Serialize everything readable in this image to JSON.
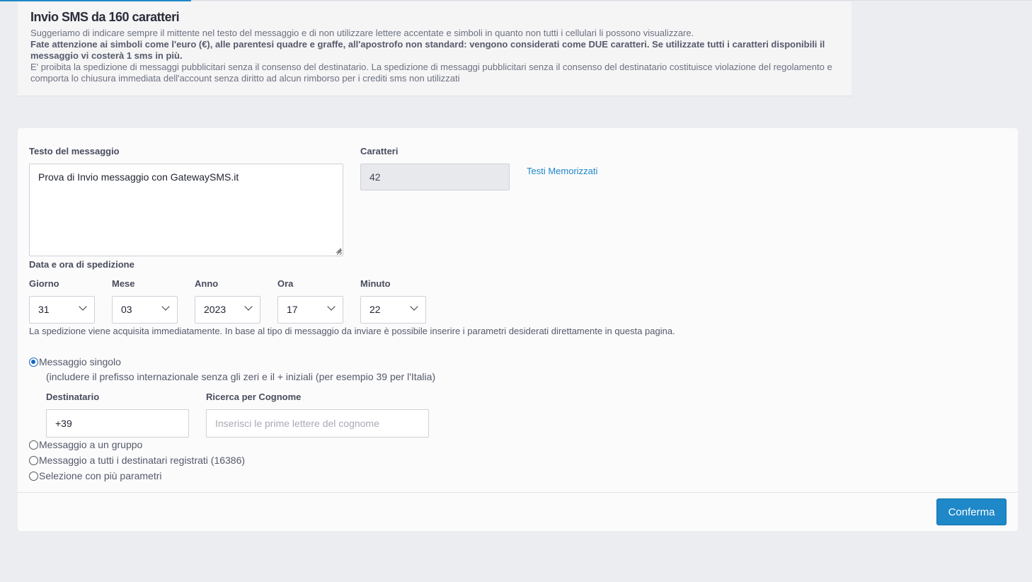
{
  "info": {
    "title": "Invio SMS da 160 caratteri",
    "line1": "Suggeriamo di indicare sempre il mittente nel testo del messaggio e di non utilizzare lettere accentate e simboli in quanto non tutti i cellulari li possono visualizzare.",
    "line2": "Fate attenzione ai simboli come l'euro (€), alle parentesi quadre e graffe, all'apostrofo non standard: vengono considerati come DUE caratteri. Se utilizzate tutti i caratteri disponibili il messaggio vi costerà 1 sms in più.",
    "line3": "E' proibita la spedizione di messaggi pubblicitari senza il consenso del destinatario. La spedizione di messaggi pubblicitari senza il consenso del destinatario costituisce violazione del regolamento e comporta lo chiusura immediata dell'account senza diritto ad alcun rimborso per i crediti sms non utilizzati"
  },
  "form": {
    "message_label": "Testo del messaggio",
    "message_value": "Prova di Invio messaggio con GatewaySMS.it",
    "chars_label": "Caratteri",
    "chars_value": "42",
    "saved_texts_link": "Testi Memorizzati",
    "datetime_label": "Data e ora di spedizione",
    "fields": {
      "day_label": "Giorno",
      "day_value": "31",
      "month_label": "Mese",
      "month_value": "03",
      "year_label": "Anno",
      "year_value": "2023",
      "hour_label": "Ora",
      "hour_value": "17",
      "minute_label": "Minuto",
      "minute_value": "22"
    },
    "note": "La spedizione viene acquisita immediatamente. In base al tipo di messaggio da inviare è possibile inserire i parametri desiderati direttamente in questa pagina.",
    "radios": {
      "single": "Messaggio singolo",
      "single_hint": "(includere il prefisso internazionale senza gli zeri e il + iniziali (per esempio 39 per l'Italia)",
      "group": "Messaggio a un gruppo",
      "all": "Messaggio a tutti i destinatari registrati (16386)",
      "params": "Selezione con più parametri"
    },
    "recipient_label": "Destinatario",
    "recipient_value": "+39",
    "search_label": "Ricerca per Cognome",
    "search_placeholder": "Inserisci le prime lettere del cognome",
    "confirm_button": "Conferma"
  },
  "colors": {
    "accent": "#1e88c8",
    "background": "#ecedf0"
  }
}
